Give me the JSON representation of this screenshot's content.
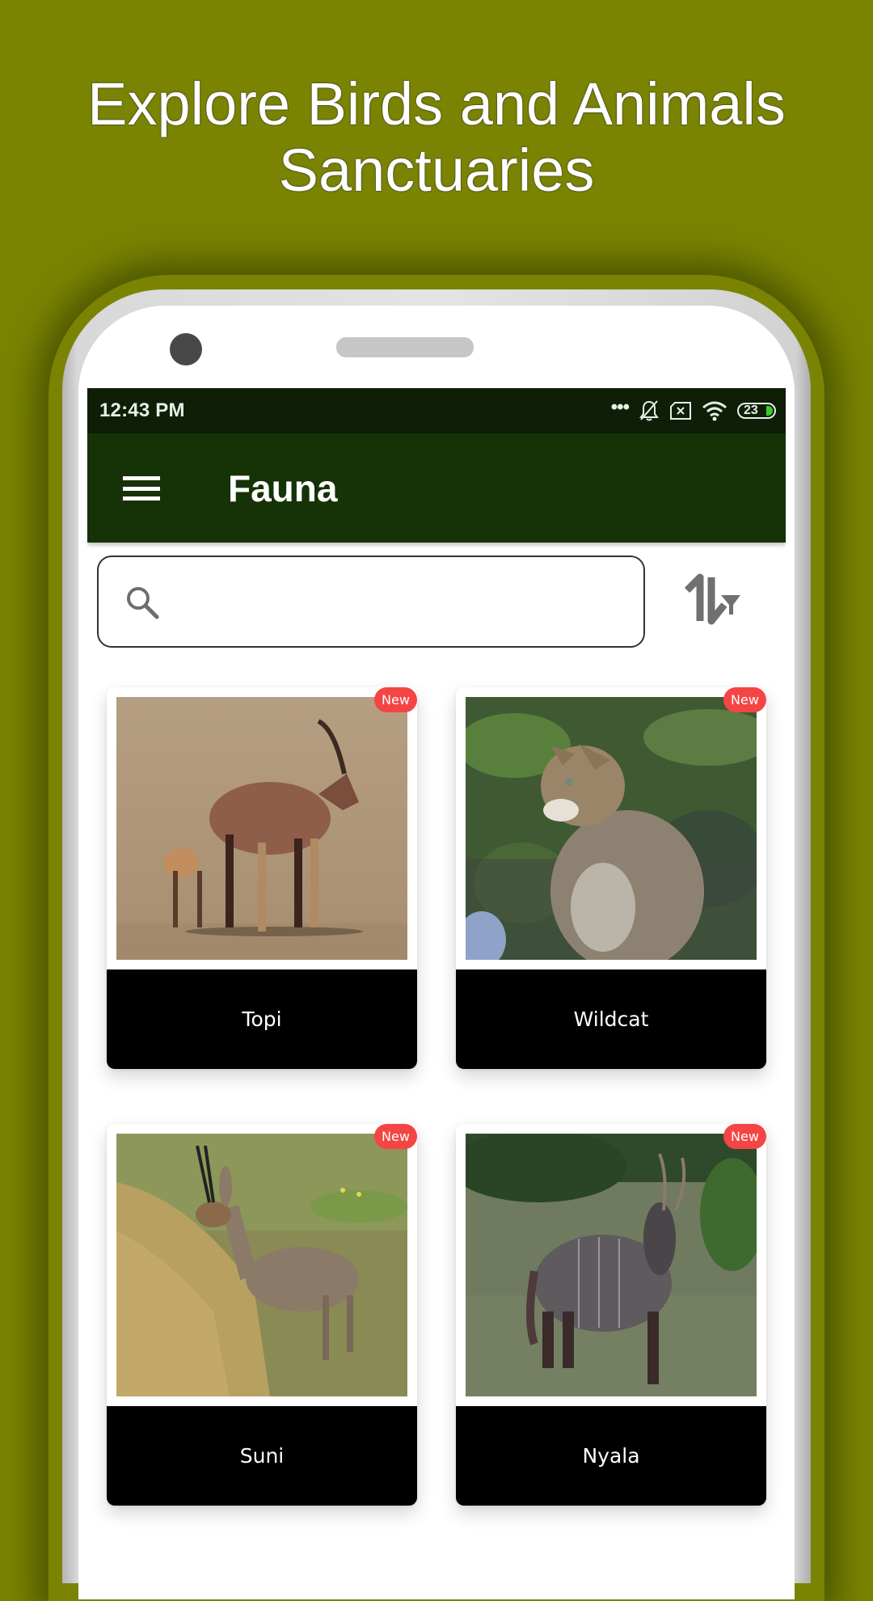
{
  "promo": {
    "title_line1": "Explore Birds and Animals",
    "title_line2": "Sanctuaries"
  },
  "status_bar": {
    "time": "12:43 PM",
    "icons": [
      "more-dots-icon",
      "notifications-off-icon",
      "no-sim-icon",
      "wifi-icon",
      "battery-icon"
    ],
    "battery_level": "23"
  },
  "toolbar": {
    "menu_icon": "hamburger-menu-icon",
    "title": "Fauna"
  },
  "search": {
    "value": "",
    "placeholder": "",
    "icon": "search-icon"
  },
  "sort_filter": {
    "icon": "sort-filter-icon"
  },
  "colors": {
    "background": "#7a8402",
    "status_bar": "#0f1e07",
    "toolbar": "#163307",
    "badge": "#f44545",
    "card_label_bg": "#000000",
    "battery_fill": "#3dcc2a"
  },
  "animals": [
    {
      "name": "Topi",
      "badge": "New",
      "image": "topi-antelope-with-calf-photo"
    },
    {
      "name": "Wildcat",
      "badge": "New",
      "image": "wildcat-photo"
    },
    {
      "name": "Suni",
      "badge": "New",
      "image": "suni-antelope-photo"
    },
    {
      "name": "Nyala",
      "badge": "New",
      "image": "nyala-antelope-photo"
    }
  ]
}
